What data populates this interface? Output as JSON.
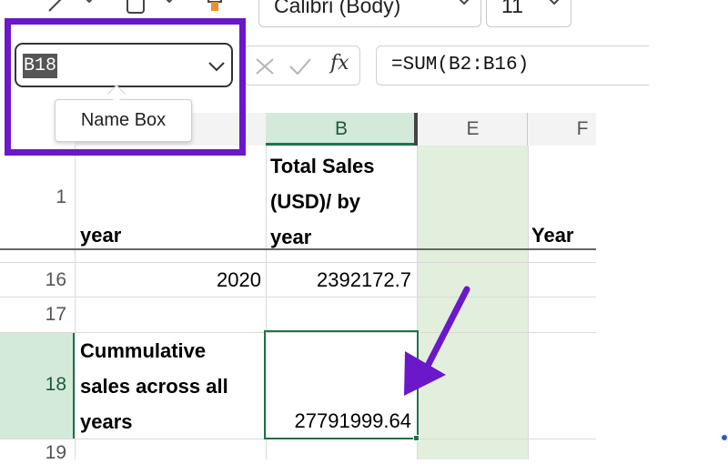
{
  "ribbon": {
    "font_name": "Calibri (Body)",
    "font_size": "11"
  },
  "formula_bar": {
    "name_box_value": "B18",
    "formula": "=SUM(B2:B16)",
    "fx_label": "fx"
  },
  "tooltip": {
    "text": "Name Box"
  },
  "columns": {
    "b": "B",
    "e": "E",
    "f": "F"
  },
  "rows": {
    "r1": {
      "num": "1",
      "a": "year",
      "b_line1": "Total Sales",
      "b_line2": "(USD)/ by",
      "b_line3": "year",
      "f": "Year"
    },
    "r16": {
      "num": "16",
      "a": "2020",
      "b": "2392172.7"
    },
    "r17": {
      "num": "17"
    },
    "r18": {
      "num": "18",
      "a_line1": "Cummulative",
      "a_line2": "sales across all",
      "a_line3": "years",
      "b": "27791999.64"
    },
    "r19": {
      "num": "19"
    }
  },
  "colors": {
    "highlight": "#6a18c9",
    "selection_border": "#217346",
    "selected_header_bg": "#d3eadb",
    "column_e_bg": "#e1efdc"
  }
}
